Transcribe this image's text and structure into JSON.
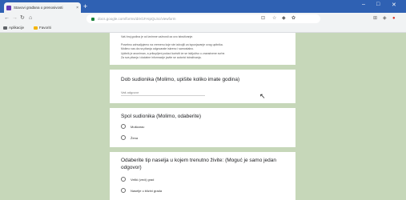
{
  "browser": {
    "tab_title": "Stavovi građana o prenosivosti",
    "tab_close": "×",
    "new_tab": "+",
    "min": "–",
    "max": "□",
    "close": "✕",
    "url": "docs.google.com/forms/d/e/1FAIpQLSc/viewform",
    "bookmarks": [
      {
        "label": "Aplikacije"
      },
      {
        "label": "Favoriti"
      }
    ]
  },
  "form": {
    "intro_lines": [
      "Vaš broj godina je od iznimne važnosti za ovo istraživanje.",
      "Posebno zahvaljujemo na vremenu koje ste izdvojili za ispunjavanje ovog upitnika.",
      "Molimo vas da na pitanja odgovarate iskreno i samostalno.",
      "Upitnik je anoniman, a prikupljeni podaci koristit će se isključivo u znanstvene svrhe.",
      "Za sva pitanja i dodatne informacije javite se autorici istraživanja."
    ],
    "q1": {
      "title": "Dob sudionika (Molimo, upišite koliko imate godina)",
      "placeholder": "Vaš odgovor"
    },
    "q2": {
      "title": "Spol sudionika (Molimo, odaberite)",
      "options": [
        "Muškarac",
        "Žena"
      ]
    },
    "q3": {
      "title": "Odaberite tip naselja u kojem trenutno živite: (Moguć je samo jedan odgovor)",
      "options": [
        "Veliki (veći) grad",
        "Naselje u blizini grada"
      ]
    }
  }
}
